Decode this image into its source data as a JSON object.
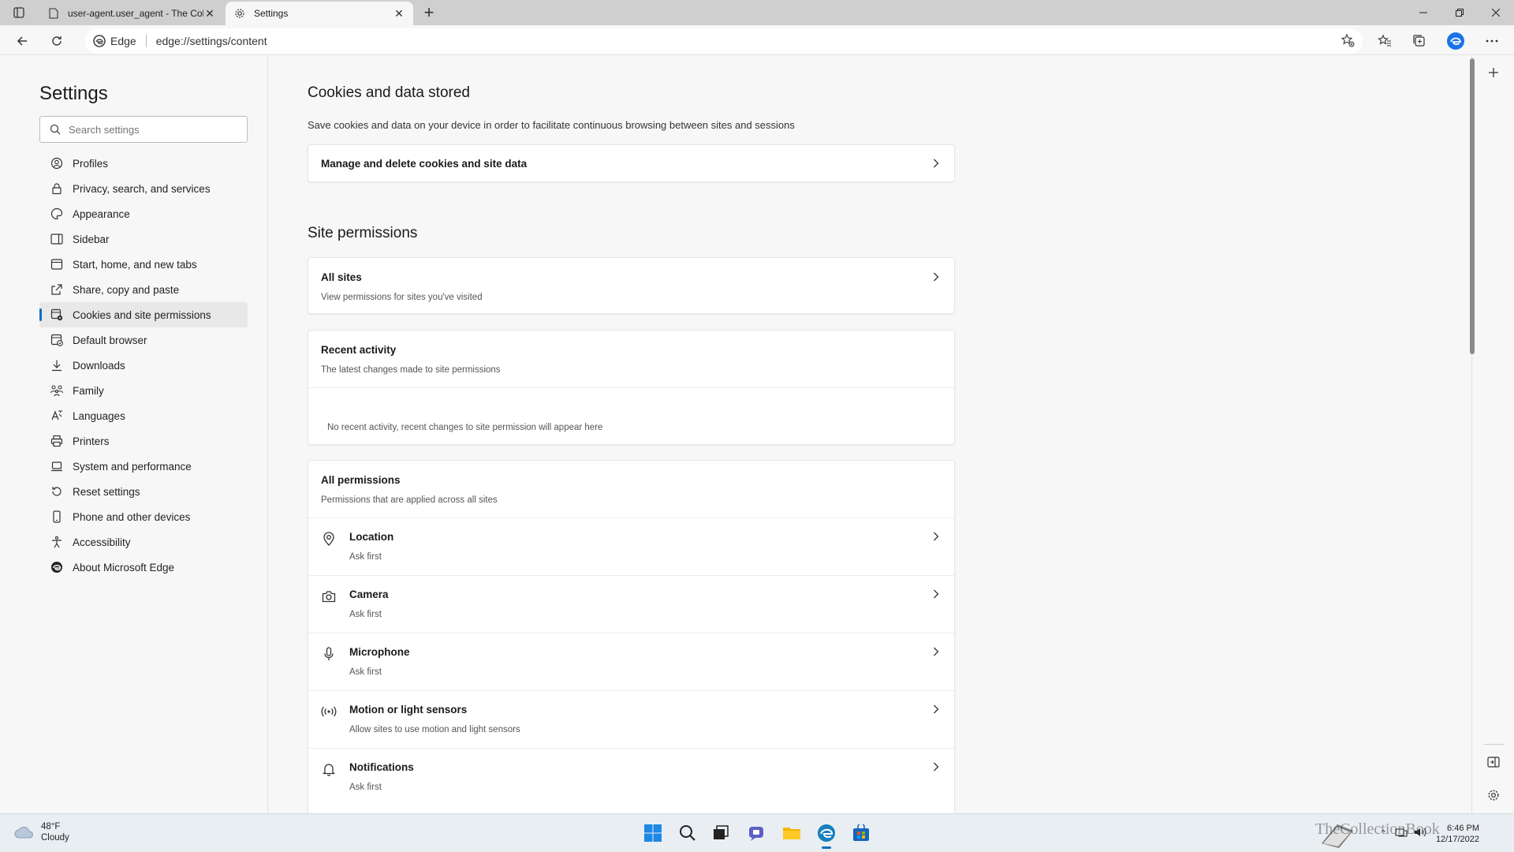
{
  "browser": {
    "tabs": [
      {
        "title": "user-agent.user_agent - The Col",
        "icon": "document-icon",
        "active": false
      },
      {
        "title": "Settings",
        "icon": "gear-icon",
        "active": true
      }
    ],
    "address": {
      "chip": "Edge",
      "url": "edge://settings/content"
    }
  },
  "sidebar": {
    "title": "Settings",
    "search_placeholder": "Search settings",
    "items": [
      {
        "label": "Profiles",
        "icon": "profile-icon"
      },
      {
        "label": "Privacy, search, and services",
        "icon": "lock-icon"
      },
      {
        "label": "Appearance",
        "icon": "appearance-icon"
      },
      {
        "label": "Sidebar",
        "icon": "sidebar-icon"
      },
      {
        "label": "Start, home, and new tabs",
        "icon": "home-tabs-icon"
      },
      {
        "label": "Share, copy and paste",
        "icon": "share-icon"
      },
      {
        "label": "Cookies and site permissions",
        "icon": "cookies-icon",
        "selected": true
      },
      {
        "label": "Default browser",
        "icon": "default-browser-icon"
      },
      {
        "label": "Downloads",
        "icon": "download-icon"
      },
      {
        "label": "Family",
        "icon": "family-icon"
      },
      {
        "label": "Languages",
        "icon": "languages-icon"
      },
      {
        "label": "Printers",
        "icon": "printer-icon"
      },
      {
        "label": "System and performance",
        "icon": "laptop-icon"
      },
      {
        "label": "Reset settings",
        "icon": "reset-icon"
      },
      {
        "label": "Phone and other devices",
        "icon": "phone-icon"
      },
      {
        "label": "Accessibility",
        "icon": "accessibility-icon"
      },
      {
        "label": "About Microsoft Edge",
        "icon": "edge-logo-icon"
      }
    ]
  },
  "main": {
    "cookies": {
      "heading": "Cookies and data stored",
      "description": "Save cookies and data on your device in order to facilitate continuous browsing between sites and sessions",
      "manage_label": "Manage and delete cookies and site data"
    },
    "site_permissions": {
      "heading": "Site permissions",
      "all_sites": {
        "title": "All sites",
        "subtitle": "View permissions for sites you've visited"
      },
      "recent_activity": {
        "title": "Recent activity",
        "subtitle": "The latest changes made to site permissions",
        "empty_text": "No recent activity, recent changes to site permission will appear here"
      },
      "all_permissions": {
        "title": "All permissions",
        "subtitle": "Permissions that are applied across all sites",
        "items": [
          {
            "title": "Location",
            "subtitle": "Ask first",
            "icon": "location-icon"
          },
          {
            "title": "Camera",
            "subtitle": "Ask first",
            "icon": "camera-icon"
          },
          {
            "title": "Microphone",
            "subtitle": "Ask first",
            "icon": "microphone-icon"
          },
          {
            "title": "Motion or light sensors",
            "subtitle": "Allow sites to use motion and light sensors",
            "icon": "sensor-icon"
          },
          {
            "title": "Notifications",
            "subtitle": "Ask first",
            "icon": "bell-icon"
          }
        ]
      }
    }
  },
  "taskbar": {
    "weather": {
      "temp": "48°F",
      "condition": "Cloudy"
    },
    "clock": {
      "time": "6:46 PM",
      "date": "12/17/2022"
    },
    "watermark": "TheCollectionBook"
  },
  "colors": {
    "accent": "#0f6cbd",
    "taskbar": "#e9eef3"
  }
}
